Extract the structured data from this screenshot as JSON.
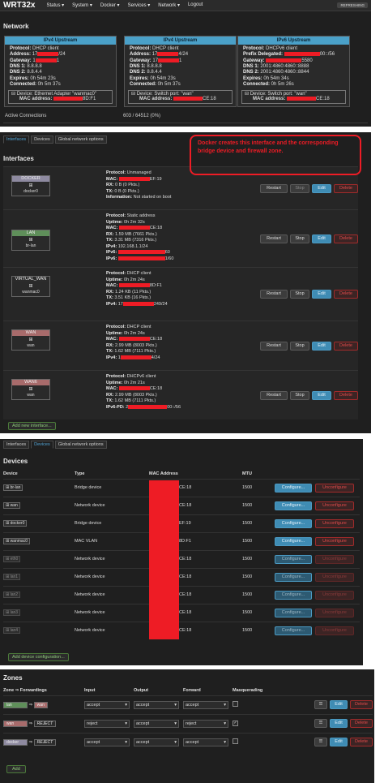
{
  "header": {
    "brand": "WRT32x",
    "menu": [
      "Status",
      "System",
      "Docker",
      "Services",
      "Network",
      "Logout"
    ],
    "badge": "REFRESHING"
  },
  "network": {
    "title": "Network",
    "cards": [
      {
        "title": "IPv4 Upstream",
        "lines": [
          {
            "k": "Protocol:",
            "v": "DHCP client"
          },
          {
            "k": "Address:",
            "v": "17",
            "tail": "/24"
          },
          {
            "k": "Gateway:",
            "v": "1",
            "tail": "1"
          },
          {
            "k": "DNS 1:",
            "v": "8.8.8.8"
          },
          {
            "k": "DNS 2:",
            "v": "8.8.4.4"
          },
          {
            "k": "Expires:",
            "v": "0h 54m 23s"
          },
          {
            "k": "Connected:",
            "v": "0h 5m 37s"
          }
        ],
        "device": "Device: Ethernet Adapter \"wanmac0\"",
        "mac_label": "MAC address:",
        "mac_tail": "8D:F1"
      },
      {
        "title": "IPv4 Upstream",
        "lines": [
          {
            "k": "Protocol:",
            "v": "DHCP client"
          },
          {
            "k": "Address:",
            "v": "17",
            "tail": "4/24"
          },
          {
            "k": "Gateway:",
            "v": "17",
            "tail": "1"
          },
          {
            "k": "DNS 1:",
            "v": "8.8.8.8"
          },
          {
            "k": "DNS 2:",
            "v": "8.8.4.4"
          },
          {
            "k": "Expires:",
            "v": "0h 54m 23s"
          },
          {
            "k": "Connected:",
            "v": "0h 5m 37s"
          }
        ],
        "device": "Device: Switch port: \"wan\"",
        "mac_label": "MAC address:",
        "mac_tail": "CE:18"
      },
      {
        "title": "IPv6 Upstream",
        "lines": [
          {
            "k": "Protocol:",
            "v": "DHCPv6 client"
          },
          {
            "k": "Prefix Delegated:",
            "v": "",
            "tail": "00::/56"
          },
          {
            "k": "Gateway:",
            "v": "",
            "tail": "5580"
          },
          {
            "k": "DNS 1:",
            "v": "2001:4860:4860::8888"
          },
          {
            "k": "DNS 2:",
            "v": "2001:4860:4860::8844"
          },
          {
            "k": "Expires:",
            "v": "0h 54m 34s"
          },
          {
            "k": "Connected:",
            "v": "0h 5m 26s"
          }
        ],
        "device": "Device: Switch port: \"wan\"",
        "mac_label": "MAC address:",
        "mac_tail": "CE:18"
      }
    ],
    "active_connections_label": "Active Connections",
    "active_connections_value": "603 / 64512 (0%)"
  },
  "interfaces_panel": {
    "tabs": [
      "Interfaces",
      "Devices",
      "Global network options"
    ],
    "title": "Interfaces",
    "annotation": "Docker creates this interface and the corresponding bridge device and firewall zone.",
    "add_label": "Add new interface...",
    "buttons": {
      "restart": "Restart",
      "stop": "Stop",
      "edit": "Edit",
      "delete": "Delete"
    },
    "rows": [
      {
        "name": "DOCKER",
        "dev": "docker0",
        "color": "#8e8aa0",
        "lines": [
          {
            "k": "Protocol:",
            "v": "Unmanaged"
          },
          {
            "k": "MAC:",
            "v": "",
            "tail": "EF:19"
          },
          {
            "k": "RX:",
            "v": "0 B (0 Pkts.)"
          },
          {
            "k": "TX:",
            "v": "0 B (0 Pkts.)"
          },
          {
            "k": "Information:",
            "v": "Not started on boot"
          }
        ]
      },
      {
        "name": "LAN",
        "dev": "br-lan",
        "color": "#5f8f5a",
        "lines": [
          {
            "k": "Protocol:",
            "v": "Static address"
          },
          {
            "k": "Uptime:",
            "v": "0h 2m 32s"
          },
          {
            "k": "MAC:",
            "v": "",
            "tail": "CE:18"
          },
          {
            "k": "RX:",
            "v": "1.59 MB (7661 Pkts.)"
          },
          {
            "k": "TX:",
            "v": "3.31 MB (7316 Pkts.)"
          },
          {
            "k": "IPv4:",
            "v": "192.168.1.1/24"
          },
          {
            "k": "IPv6:",
            "v": "",
            "tail": "60"
          },
          {
            "k": "IPv6:",
            "v": "",
            "tail": "1/60"
          }
        ]
      },
      {
        "name": "VIRTUAL_WAN",
        "dev": "wanmac0",
        "color": "#2b2b2b",
        "lines": [
          {
            "k": "Protocol:",
            "v": "DHCP client"
          },
          {
            "k": "Uptime:",
            "v": "0h 2m 24s"
          },
          {
            "k": "MAC:",
            "v": "",
            "tail": "8D:F1"
          },
          {
            "k": "RX:",
            "v": "1.24 KB (11 Pkts.)"
          },
          {
            "k": "TX:",
            "v": "3.51 KB (16 Pkts.)"
          },
          {
            "k": "IPv4:",
            "v": "17",
            "tail": "249/24"
          }
        ]
      },
      {
        "name": "WAN",
        "dev": "wan",
        "color": "#a86b6b",
        "lines": [
          {
            "k": "Protocol:",
            "v": "DHCP client"
          },
          {
            "k": "Uptime:",
            "v": "0h 2m 24s"
          },
          {
            "k": "MAC:",
            "v": "",
            "tail": "CE:18"
          },
          {
            "k": "RX:",
            "v": "2.99 MB (8003 Pkts.)"
          },
          {
            "k": "TX:",
            "v": "1.62 MB (7111 Pkts.)"
          },
          {
            "k": "IPv4:",
            "v": "1",
            "tail": "4/24"
          }
        ]
      },
      {
        "name": "WAN6",
        "dev": "wan",
        "color": "#a86b6b",
        "lines": [
          {
            "k": "Protocol:",
            "v": "DHCPv6 client"
          },
          {
            "k": "Uptime:",
            "v": "0h 2m 21s"
          },
          {
            "k": "MAC:",
            "v": "",
            "tail": "CE:18"
          },
          {
            "k": "RX:",
            "v": "2.99 MB (8003 Pkts.)"
          },
          {
            "k": "TX:",
            "v": "1.62 MB (7111 Pkts.)"
          },
          {
            "k": "IPv6-PD:",
            "v": "2",
            "tail": "00::/56"
          }
        ]
      }
    ]
  },
  "devices_panel": {
    "tabs": [
      "Interfaces",
      "Devices",
      "Global network options"
    ],
    "title": "Devices",
    "headers": [
      "Device",
      "Type",
      "MAC Address",
      "MTU"
    ],
    "configure": "Configure...",
    "unconfigure": "Unconfigure",
    "add_label": "Add device configuration...",
    "rows": [
      {
        "dev": "br-lan",
        "type": "Bridge device",
        "mac": "CE:18",
        "mtu": "1500",
        "dim": false
      },
      {
        "dev": "wan",
        "type": "Network device",
        "mac": "CE:18",
        "mtu": "1500",
        "dim": false
      },
      {
        "dev": "docker0",
        "type": "Bridge device",
        "mac": "EF:19",
        "mtu": "1500",
        "dim": false
      },
      {
        "dev": "wanmac0",
        "type": "MAC VLAN",
        "mac": "8D:F1",
        "mtu": "1500",
        "dim": false
      },
      {
        "dev": "eth0",
        "type": "Network device",
        "mac": "CE:18",
        "mtu": "1500",
        "dim": true
      },
      {
        "dev": "lan1",
        "type": "Network device",
        "mac": "CE:18",
        "mtu": "1500",
        "dim": true
      },
      {
        "dev": "lan2",
        "type": "Network device",
        "mac": "CE:18",
        "mtu": "1500",
        "dim": true
      },
      {
        "dev": "lan3",
        "type": "Network device",
        "mac": "CE:18",
        "mtu": "1500",
        "dim": true
      },
      {
        "dev": "lan4",
        "type": "Network device",
        "mac": "CE:18",
        "mtu": "1500",
        "dim": true
      }
    ]
  },
  "zones_panel": {
    "title": "Zones",
    "headers": [
      "Zone ⇒ Forwardings",
      "Input",
      "Output",
      "Forward",
      "Masquerading"
    ],
    "edit": "Edit",
    "delete": "Delete",
    "add": "Add",
    "rows": [
      {
        "zone": "lan",
        "zcolor": "#5f8f5a",
        "fwd": "wan",
        "fcolor": "#a86b6b",
        "input": "accept",
        "output": "accept",
        "forward": "accept",
        "masq": false
      },
      {
        "zone": "wan",
        "zcolor": "#a86b6b",
        "fwd": "REJECT",
        "fcolor": "#2b2b2b",
        "input": "reject",
        "output": "accept",
        "forward": "reject",
        "masq": true
      },
      {
        "zone": "docker",
        "zcolor": "#8e8aa0",
        "fwd": "REJECT",
        "fcolor": "#2b2b2b",
        "input": "accept",
        "output": "accept",
        "forward": "accept",
        "masq": false
      }
    ]
  }
}
